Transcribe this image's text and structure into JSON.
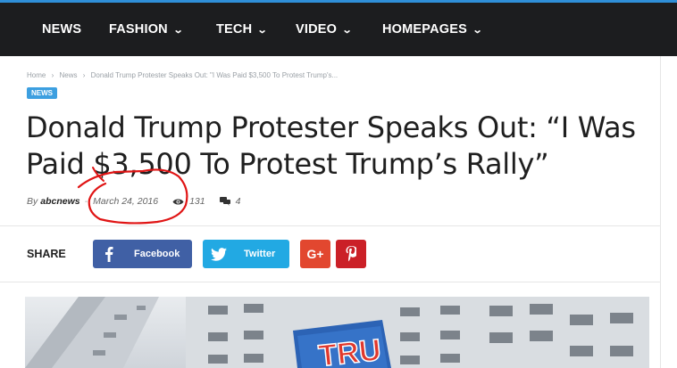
{
  "nav": {
    "items": [
      {
        "label": "NEWS"
      },
      {
        "label": "FASHION"
      },
      {
        "label": "TECH"
      },
      {
        "label": "VIDEO"
      },
      {
        "label": "HOMEPAGES"
      }
    ],
    "chevron_icon": "chevron-down-icon"
  },
  "breadcrumb": {
    "home": "Home",
    "sep": "›",
    "news": "News",
    "current": "Donald Trump Protester Speaks Out: \"I Was Paid $3,500 To Protest Trump's..."
  },
  "article": {
    "category": "NEWS",
    "title": "Donald Trump Protester Speaks Out: “I Was Paid $3,500 To Protest Trump’s Rally”",
    "by": "By",
    "author": "abcnews",
    "date": "March 24, 2016",
    "views": "131",
    "comments": "4"
  },
  "share": {
    "label": "SHARE",
    "facebook": "Facebook",
    "twitter": "Twitter",
    "googleplus": "G+"
  },
  "hero_image": {
    "sign_text": "TRU"
  },
  "colors": {
    "nav_bg": "#1c1d1f",
    "accent": "#2f8fd8",
    "badge": "#3c9fe0",
    "facebook": "#4060a5",
    "twitter": "#22a9e3",
    "googleplus": "#e2472f",
    "pinterest": "#cb2027",
    "annotation": "#e01414"
  }
}
